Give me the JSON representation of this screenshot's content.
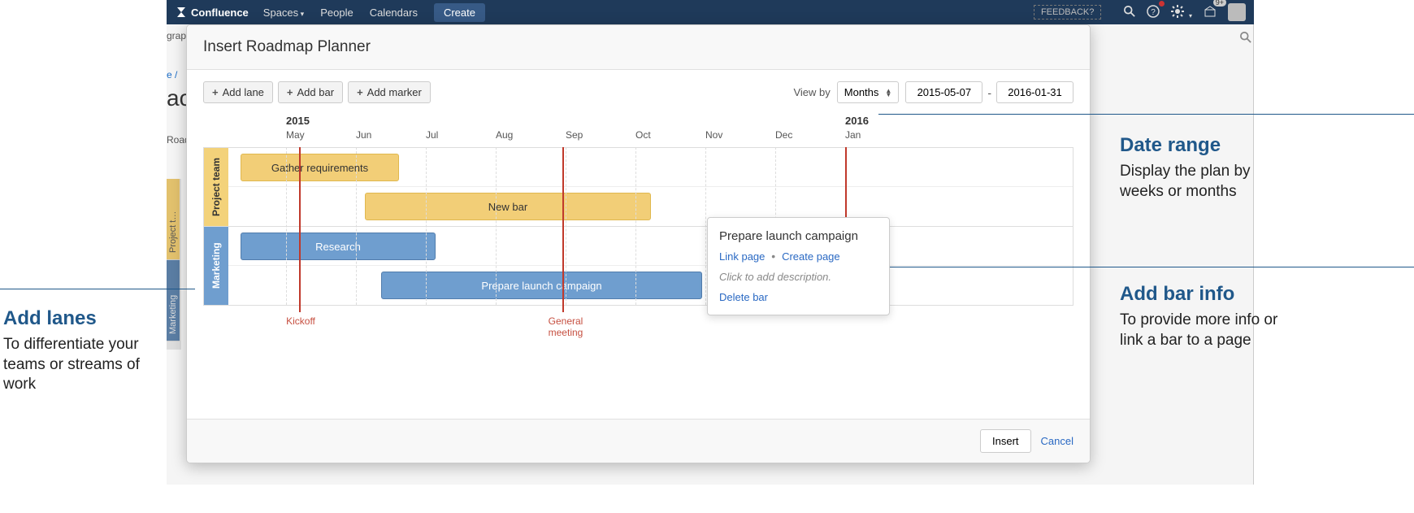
{
  "nav": {
    "brand": "Confluence",
    "items": [
      "Spaces",
      "People",
      "Calendars"
    ],
    "create": "Create",
    "feedback": "FEEDBACK?",
    "notif_badge": "9+"
  },
  "ghost": {
    "crumb": "e /",
    "title": "ac",
    "side_road": "Road",
    "side_grap": "grap",
    "vt_project": "Project t…",
    "vt_marketing": "Marketing"
  },
  "modal": {
    "title": "Insert Roadmap Planner",
    "add_lane": "Add lane",
    "add_bar": "Add bar",
    "add_marker": "Add marker",
    "view_by": "View by",
    "view_sel": "Months",
    "date_from": "2015-05-07",
    "date_to": "2016-01-31",
    "dash": "-",
    "insert": "Insert",
    "cancel": "Cancel"
  },
  "timeline": {
    "year1": "2015",
    "year2": "2016",
    "months": [
      "May",
      "Jun",
      "Jul",
      "Aug",
      "Sep",
      "Oct",
      "Nov",
      "Dec",
      "Jan"
    ]
  },
  "lanes": {
    "project": {
      "name": "Project team",
      "bar1": "Gather requirements",
      "bar2": "New bar"
    },
    "marketing": {
      "name": "Marketing",
      "bar1": "Research",
      "bar2": "Prepare launch campaign"
    }
  },
  "markers": {
    "kickoff": "Kickoff",
    "meeting": "General\nmeeting"
  },
  "popover": {
    "title": "Prepare launch campaign",
    "link_page": "Link page",
    "create_page": "Create page",
    "desc": "Click to add description.",
    "delete": "Delete bar"
  },
  "annotations": {
    "lanes_h": "Add lanes",
    "lanes_p": "To differentiate your teams or streams of work",
    "date_h": "Date range",
    "date_p": "Display the plan by weeks or months",
    "bar_h": "Add bar info",
    "bar_p": "To provide more info or link a bar to a page"
  }
}
